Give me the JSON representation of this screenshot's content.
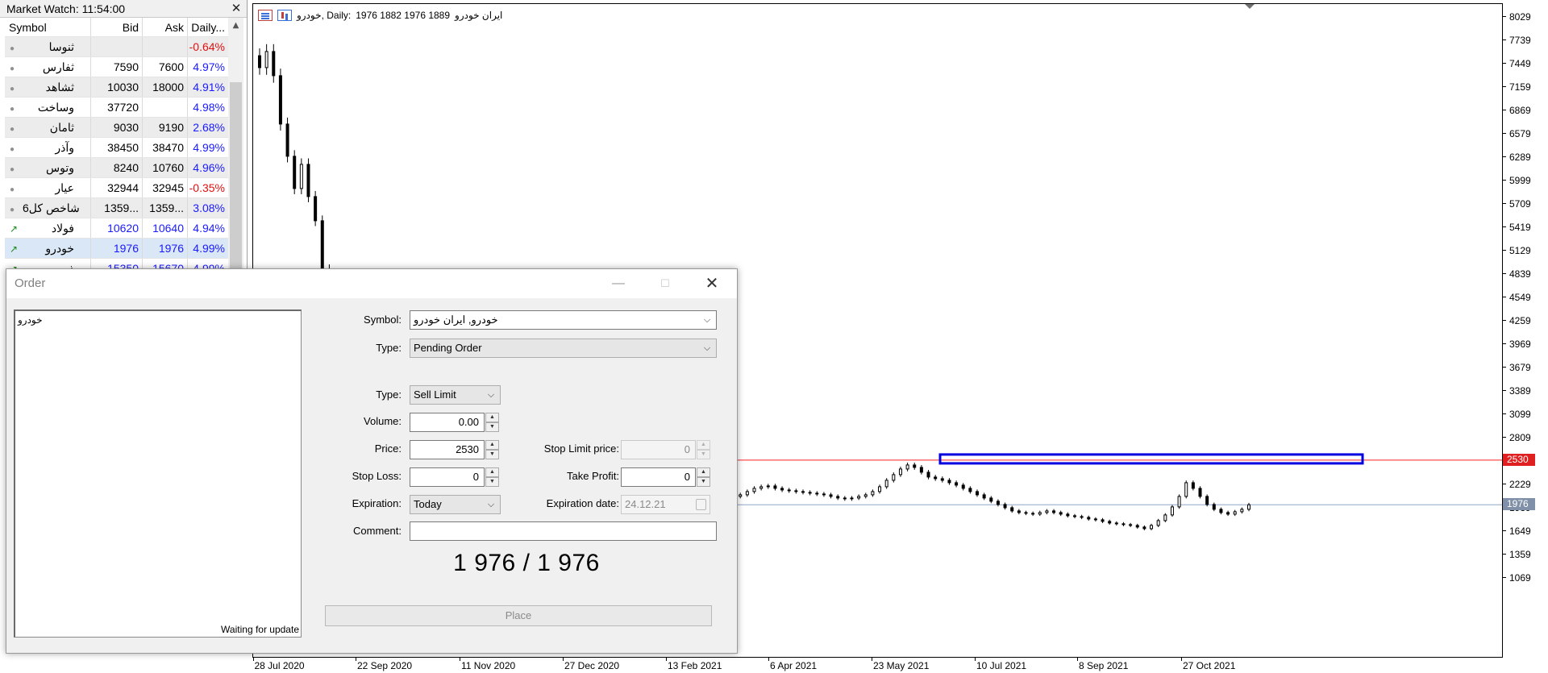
{
  "market_watch": {
    "title": "Market Watch: 11:54:00",
    "close_glyph": "✕",
    "columns": {
      "symbol": "Symbol",
      "bid": "Bid",
      "ask": "Ask",
      "daily": "Daily..."
    },
    "rows": [
      {
        "symbol": "ثنوسا",
        "bid": "",
        "ask": "",
        "daily": "-0.64%",
        "trend": "down",
        "marker": "dot"
      },
      {
        "symbol": "ثفارس",
        "bid": "7590",
        "ask": "7600",
        "daily": "4.97%",
        "trend": "up",
        "marker": "dot"
      },
      {
        "symbol": "ثشاهد",
        "bid": "10030",
        "ask": "18000",
        "daily": "4.91%",
        "trend": "up",
        "marker": "dot"
      },
      {
        "symbol": "وساخت",
        "bid": "37720",
        "ask": "",
        "daily": "4.98%",
        "trend": "up",
        "marker": "dot"
      },
      {
        "symbol": "ثامان",
        "bid": "9030",
        "ask": "9190",
        "daily": "2.68%",
        "trend": "up",
        "marker": "dot"
      },
      {
        "symbol": "وآذر",
        "bid": "38450",
        "ask": "38470",
        "daily": "4.99%",
        "trend": "up",
        "marker": "dot"
      },
      {
        "symbol": "وتوس",
        "bid": "8240",
        "ask": "10760",
        "daily": "4.96%",
        "trend": "up",
        "marker": "dot"
      },
      {
        "symbol": "عيار",
        "bid": "32944",
        "ask": "32945",
        "daily": "-0.35%",
        "trend": "down",
        "marker": "dot"
      },
      {
        "symbol": "شاخص كل6",
        "bid": "1359...",
        "ask": "1359...",
        "daily": "3.08%",
        "trend": "up",
        "marker": "dot"
      },
      {
        "symbol": "فولاد",
        "bid": "10620",
        "ask": "10640",
        "daily": "4.94%",
        "trend": "up",
        "marker": "arrow",
        "colored": true
      },
      {
        "symbol": "خودرو",
        "bid": "1976",
        "ask": "1976",
        "daily": "4.99%",
        "trend": "up",
        "marker": "arrow",
        "colored": true,
        "selected": true
      },
      {
        "symbol": "ذوب",
        "bid": "15350",
        "ask": "15670",
        "daily": "4.99%",
        "trend": "up",
        "marker": "arrow",
        "colored": true
      }
    ]
  },
  "chart": {
    "header_symbol": "خودرو, Daily:",
    "header_ohlc": "1976 1882 1976 1889",
    "header_name": "ایران خودرو",
    "y_ticks": [
      "8029",
      "7739",
      "7449",
      "7159",
      "6869",
      "6579",
      "6289",
      "5999",
      "5709",
      "5419",
      "5129",
      "4839",
      "4549",
      "4259",
      "3969",
      "3679",
      "3389",
      "3099",
      "2809",
      "2519",
      "2229",
      "1939",
      "1649",
      "1359",
      "1069"
    ],
    "x_ticks": [
      "28 Jul 2020",
      "22 Sep 2020",
      "11 Nov 2020",
      "27 Dec 2020",
      "13 Feb 2021",
      "6 Apr 2021",
      "23 May 2021",
      "10 Jul 2021",
      "8 Sep 2021",
      "27 Oct 2021"
    ],
    "price_tags": [
      {
        "label": "2530",
        "value": 2530,
        "color": "#e02020"
      },
      {
        "label": "1976",
        "value": 1976,
        "color": "#8090a8"
      }
    ],
    "level_line_color": "#ff2020",
    "current_line_color": "#8fa6c8",
    "zone_color": "#0000e0",
    "candle_color": "#000000",
    "ylim": [
      900,
      8150
    ]
  },
  "chart_data": {
    "type": "candlestick",
    "title": "خودرو, Daily: 1976 1882 1976 1889 ایران خودرو",
    "x_start": "28 Jul 2020",
    "x_end": "1 Dec 2021",
    "closes": [
      7400,
      7600,
      7300,
      6700,
      6300,
      5900,
      6200,
      5800,
      5500,
      4900,
      4700,
      4300,
      4000,
      3700,
      3550,
      3400,
      3300,
      3150,
      3000,
      2950,
      2850,
      2780,
      2720,
      2700,
      2690,
      2680,
      2700,
      2720,
      2750,
      2760,
      2760,
      2770,
      2760,
      2740,
      2700,
      2650,
      2600,
      2560,
      2520,
      2500,
      2480,
      2450,
      2420,
      2390,
      2350,
      2320,
      2280,
      2240,
      2200,
      2170,
      2120,
      2080,
      2040,
      2000,
      1960,
      1920,
      1860,
      1800,
      1740,
      1700,
      1720,
      1780,
      1820,
      1860,
      1900,
      1960,
      2000,
      2060,
      2080,
      2100,
      2140,
      2180,
      2200,
      2210,
      2180,
      2160,
      2150,
      2140,
      2130,
      2120,
      2110,
      2100,
      2080,
      2060,
      2050,
      2060,
      2080,
      2100,
      2140,
      2200,
      2280,
      2350,
      2420,
      2470,
      2440,
      2380,
      2320,
      2300,
      2280,
      2250,
      2220,
      2180,
      2140,
      2100,
      2060,
      2020,
      1980,
      1940,
      1900,
      1880,
      1870,
      1860,
      1880,
      1900,
      1880,
      1860,
      1840,
      1830,
      1820,
      1800,
      1790,
      1770,
      1750,
      1740,
      1730,
      1720,
      1700,
      1680,
      1720,
      1780,
      1850,
      1950,
      2080,
      2250,
      2180,
      2080,
      1980,
      1920,
      1880,
      1860,
      1890,
      1920,
      1976
    ],
    "level_line": 2530,
    "current_price": 1976
  },
  "order": {
    "title": "Order",
    "tick_symbol": "خودرو",
    "tick_status": "Waiting for update",
    "symbol_label": "Symbol:",
    "symbol_value": "خودرو, ایران خودرو",
    "type_label": "Type:",
    "type_value": "Pending Order",
    "order_type_label": "Type:",
    "order_type_value": "Sell Limit",
    "volume_label": "Volume:",
    "volume_value": "0.00",
    "price_label": "Price:",
    "price_value": "2530",
    "stop_limit_label": "Stop Limit price:",
    "stop_limit_value": "0",
    "stop_loss_label": "Stop Loss:",
    "stop_loss_value": "0",
    "take_profit_label": "Take Profit:",
    "take_profit_value": "0",
    "expiration_label": "Expiration:",
    "expiration_value": "Today",
    "expiration_date_label": "Expiration date:",
    "expiration_date_value": "24.12.21",
    "comment_label": "Comment:",
    "comment_value": "",
    "quote": "1 976 / 1 976",
    "place_label": "Place"
  }
}
